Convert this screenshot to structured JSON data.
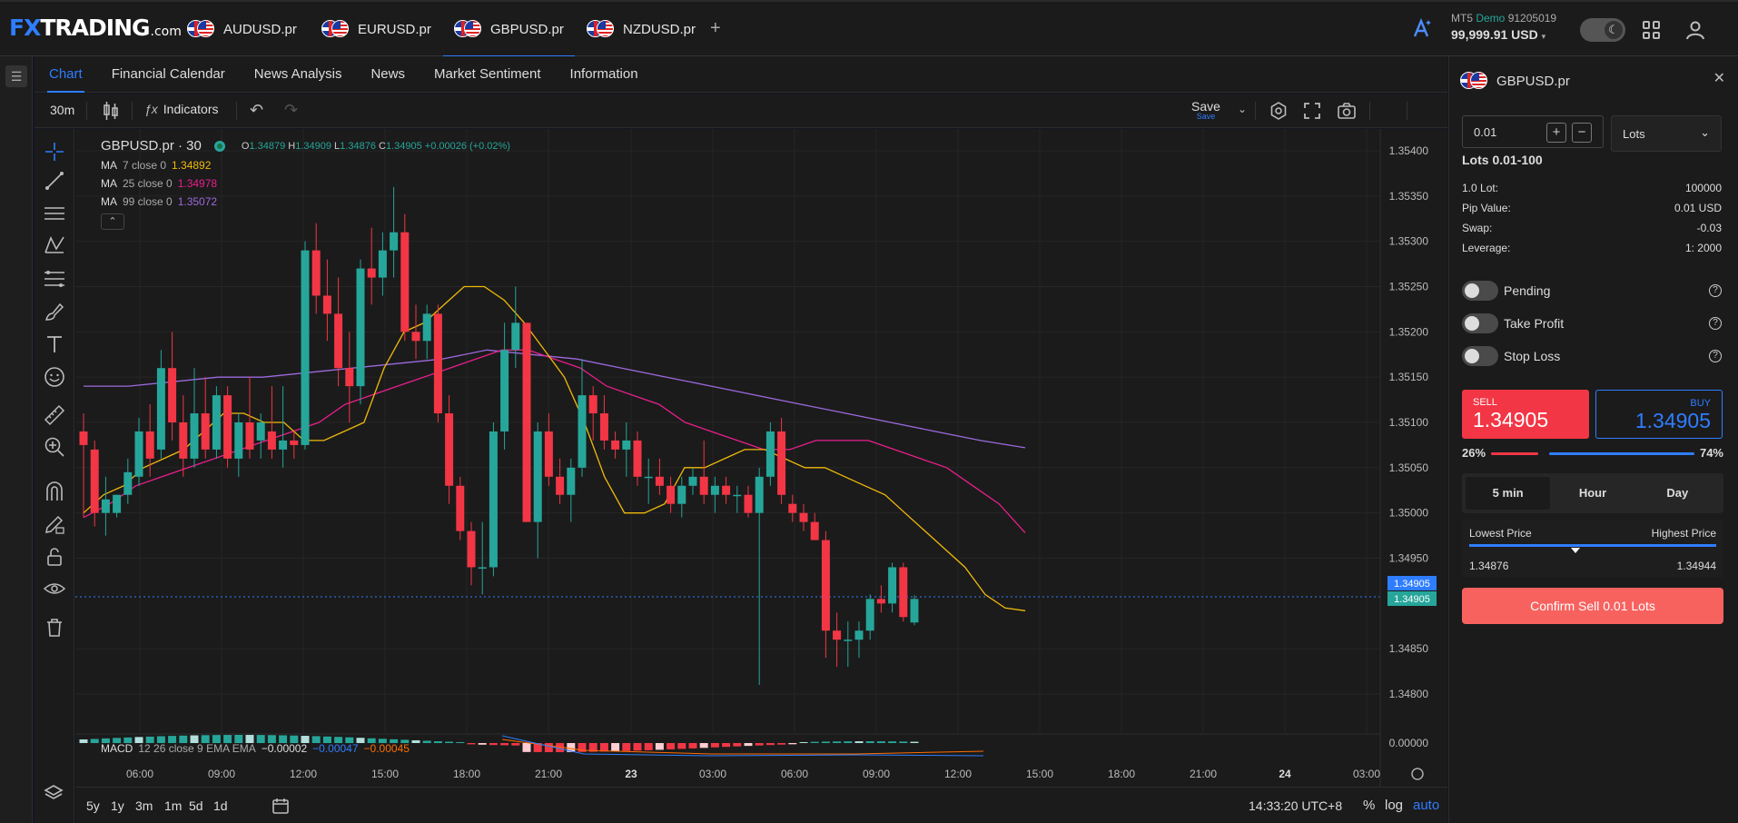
{
  "brand": {
    "logo_fx": "FX",
    "logo_trading": "TRADING",
    "logo_com": ".com"
  },
  "symbol_tabs": [
    {
      "label": "AUDUSD.pr",
      "active": false
    },
    {
      "label": "EURUSD.pr",
      "active": false
    },
    {
      "label": "GBPUSD.pr",
      "active": true
    },
    {
      "label": "NZDUSD.pr",
      "active": false
    }
  ],
  "add_tab_icon": "plus-icon",
  "account": {
    "platform": "MT5",
    "mode": "Demo",
    "number": "91205019",
    "balance": "99,999.91 USD"
  },
  "sub_tabs": [
    "Chart",
    "Financial Calendar",
    "News Analysis",
    "News",
    "Market Sentiment",
    "Information"
  ],
  "active_sub_tab": "Chart",
  "toolbar": {
    "interval": "30m",
    "indicators": "Indicators",
    "save": "Save",
    "save_sub": "Save"
  },
  "legend": {
    "symbol": "GBPUSD.pr · 30",
    "ohlc": {
      "o_label": "O",
      "o": "1.34879",
      "h_label": "H",
      "h": "1.34909",
      "l_label": "L",
      "l": "1.34876",
      "c_label": "C",
      "c": "1.34905",
      "chg": "+0.00026 (+0.02%)"
    },
    "ma": [
      {
        "name": "MA",
        "params": "7 close 0",
        "value": "1.34892",
        "color": "#f0b90b"
      },
      {
        "name": "MA",
        "params": "25 close 0",
        "value": "1.34978",
        "color": "#e91e8c"
      },
      {
        "name": "MA",
        "params": "99 close 0",
        "value": "1.35072",
        "color": "#9c6ade"
      }
    ],
    "macd": {
      "name": "MACD",
      "params": "12 26 close 9 EMA EMA",
      "v1": "−0.00002",
      "v2": "−0.00047",
      "v3": "−0.00045"
    }
  },
  "chart_data": {
    "type": "candlestick",
    "symbol": "GBPUSD.pr",
    "timeframe": "30",
    "y_ticks": [
      "1.35400",
      "1.35350",
      "1.35300",
      "1.35250",
      "1.35200",
      "1.35150",
      "1.35100",
      "1.35050",
      "1.35000",
      "1.34950",
      "1.34850",
      "1.34800"
    ],
    "ylim": [
      1.34795,
      1.354
    ],
    "macd_tick": "0.00000",
    "x_ticks": [
      "06:00",
      "09:00",
      "12:00",
      "15:00",
      "18:00",
      "21:00",
      "23",
      "03:00",
      "06:00",
      "09:00",
      "12:00",
      "15:00",
      "18:00",
      "21:00",
      "24",
      "03:00"
    ],
    "price_labels": [
      "1.34905",
      "1.34905"
    ],
    "candles": [
      {
        "o": 1.3509,
        "h": 1.3511,
        "l": 1.34995,
        "c": 1.35075
      },
      {
        "o": 1.3507,
        "h": 1.3508,
        "l": 1.34985,
        "c": 1.35
      },
      {
        "o": 1.35,
        "h": 1.3504,
        "l": 1.34975,
        "c": 1.35015
      },
      {
        "o": 1.35,
        "h": 1.3502,
        "l": 1.34995,
        "c": 1.3502
      },
      {
        "o": 1.3502,
        "h": 1.3506,
        "l": 1.3501,
        "c": 1.35045
      },
      {
        "o": 1.3504,
        "h": 1.35105,
        "l": 1.3503,
        "c": 1.3509
      },
      {
        "o": 1.3509,
        "h": 1.3512,
        "l": 1.3504,
        "c": 1.3506
      },
      {
        "o": 1.3507,
        "h": 1.3518,
        "l": 1.3506,
        "c": 1.3516
      },
      {
        "o": 1.3516,
        "h": 1.352,
        "l": 1.3508,
        "c": 1.351
      },
      {
        "o": 1.351,
        "h": 1.3513,
        "l": 1.3504,
        "c": 1.3506
      },
      {
        "o": 1.3506,
        "h": 1.3516,
        "l": 1.3505,
        "c": 1.3511
      },
      {
        "o": 1.3511,
        "h": 1.3515,
        "l": 1.3506,
        "c": 1.3507
      },
      {
        "o": 1.3507,
        "h": 1.3514,
        "l": 1.3506,
        "c": 1.3513
      },
      {
        "o": 1.3513,
        "h": 1.3514,
        "l": 1.3505,
        "c": 1.3506
      },
      {
        "o": 1.3506,
        "h": 1.3511,
        "l": 1.3504,
        "c": 1.351
      },
      {
        "o": 1.351,
        "h": 1.3515,
        "l": 1.3506,
        "c": 1.3507
      },
      {
        "o": 1.3508,
        "h": 1.3511,
        "l": 1.3506,
        "c": 1.351
      },
      {
        "o": 1.3509,
        "h": 1.3514,
        "l": 1.3506,
        "c": 1.3507
      },
      {
        "o": 1.3507,
        "h": 1.3514,
        "l": 1.3505,
        "c": 1.3508
      },
      {
        "o": 1.3508,
        "h": 1.3509,
        "l": 1.3506,
        "c": 1.35075
      },
      {
        "o": 1.35075,
        "h": 1.353,
        "l": 1.3507,
        "c": 1.3529
      },
      {
        "o": 1.3529,
        "h": 1.3532,
        "l": 1.3522,
        "c": 1.3524
      },
      {
        "o": 1.3524,
        "h": 1.3528,
        "l": 1.3519,
        "c": 1.3522
      },
      {
        "o": 1.3522,
        "h": 1.3526,
        "l": 1.3514,
        "c": 1.3516
      },
      {
        "o": 1.3516,
        "h": 1.352,
        "l": 1.351,
        "c": 1.3514
      },
      {
        "o": 1.3514,
        "h": 1.3528,
        "l": 1.3512,
        "c": 1.3527
      },
      {
        "o": 1.3527,
        "h": 1.35315,
        "l": 1.3523,
        "c": 1.3526
      },
      {
        "o": 1.3526,
        "h": 1.3531,
        "l": 1.3524,
        "c": 1.3529
      },
      {
        "o": 1.3529,
        "h": 1.3536,
        "l": 1.3526,
        "c": 1.3531
      },
      {
        "o": 1.3531,
        "h": 1.3533,
        "l": 1.3519,
        "c": 1.352
      },
      {
        "o": 1.352,
        "h": 1.3523,
        "l": 1.3517,
        "c": 1.3519
      },
      {
        "o": 1.3519,
        "h": 1.3523,
        "l": 1.3517,
        "c": 1.3522
      },
      {
        "o": 1.3522,
        "h": 1.3523,
        "l": 1.351,
        "c": 1.3511
      },
      {
        "o": 1.3511,
        "h": 1.3513,
        "l": 1.3501,
        "c": 1.3503
      },
      {
        "o": 1.3503,
        "h": 1.3504,
        "l": 1.3497,
        "c": 1.3498
      },
      {
        "o": 1.3498,
        "h": 1.3499,
        "l": 1.3492,
        "c": 1.3494
      },
      {
        "o": 1.3494,
        "h": 1.3499,
        "l": 1.3491,
        "c": 1.3494
      },
      {
        "o": 1.3494,
        "h": 1.351,
        "l": 1.3493,
        "c": 1.3509
      },
      {
        "o": 1.3509,
        "h": 1.3521,
        "l": 1.3507,
        "c": 1.3518
      },
      {
        "o": 1.3518,
        "h": 1.3525,
        "l": 1.3516,
        "c": 1.3521
      },
      {
        "o": 1.3521,
        "h": 1.3521,
        "l": 1.3499,
        "c": 1.3499
      },
      {
        "o": 1.3499,
        "h": 1.351,
        "l": 1.3495,
        "c": 1.3509
      },
      {
        "o": 1.3509,
        "h": 1.3511,
        "l": 1.3503,
        "c": 1.3504
      },
      {
        "o": 1.3504,
        "h": 1.3506,
        "l": 1.3501,
        "c": 1.3502
      },
      {
        "o": 1.3502,
        "h": 1.3506,
        "l": 1.3499,
        "c": 1.3505
      },
      {
        "o": 1.3505,
        "h": 1.3517,
        "l": 1.3504,
        "c": 1.3513
      },
      {
        "o": 1.3513,
        "h": 1.3514,
        "l": 1.3508,
        "c": 1.3511
      },
      {
        "o": 1.3511,
        "h": 1.3513,
        "l": 1.3507,
        "c": 1.3508
      },
      {
        "o": 1.3508,
        "h": 1.3509,
        "l": 1.3506,
        "c": 1.3507
      },
      {
        "o": 1.3507,
        "h": 1.351,
        "l": 1.3504,
        "c": 1.3508
      },
      {
        "o": 1.3508,
        "h": 1.3509,
        "l": 1.3503,
        "c": 1.3504
      },
      {
        "o": 1.3504,
        "h": 1.3506,
        "l": 1.3501,
        "c": 1.3504
      },
      {
        "o": 1.3504,
        "h": 1.3506,
        "l": 1.3502,
        "c": 1.3503
      },
      {
        "o": 1.3503,
        "h": 1.3504,
        "l": 1.35,
        "c": 1.3501
      },
      {
        "o": 1.3501,
        "h": 1.3504,
        "l": 1.34995,
        "c": 1.3503
      },
      {
        "o": 1.3503,
        "h": 1.3505,
        "l": 1.3502,
        "c": 1.3504
      },
      {
        "o": 1.3504,
        "h": 1.3508,
        "l": 1.3501,
        "c": 1.3502
      },
      {
        "o": 1.3502,
        "h": 1.3504,
        "l": 1.35,
        "c": 1.3503
      },
      {
        "o": 1.3503,
        "h": 1.3504,
        "l": 1.3501,
        "c": 1.3502
      },
      {
        "o": 1.3502,
        "h": 1.3503,
        "l": 1.35,
        "c": 1.3502
      },
      {
        "o": 1.3502,
        "h": 1.3503,
        "l": 1.34995,
        "c": 1.35
      },
      {
        "o": 1.35,
        "h": 1.3505,
        "l": 1.3481,
        "c": 1.3504
      },
      {
        "o": 1.3504,
        "h": 1.351,
        "l": 1.3503,
        "c": 1.3509
      },
      {
        "o": 1.3509,
        "h": 1.35105,
        "l": 1.3501,
        "c": 1.3502
      },
      {
        "o": 1.3501,
        "h": 1.3502,
        "l": 1.3499,
        "c": 1.35
      },
      {
        "o": 1.35,
        "h": 1.3501,
        "l": 1.3498,
        "c": 1.3499
      },
      {
        "o": 1.3499,
        "h": 1.35,
        "l": 1.3497,
        "c": 1.3497
      },
      {
        "o": 1.3497,
        "h": 1.3498,
        "l": 1.3484,
        "c": 1.3487
      },
      {
        "o": 1.3487,
        "h": 1.3489,
        "l": 1.3483,
        "c": 1.3486
      },
      {
        "o": 1.3486,
        "h": 1.3488,
        "l": 1.3483,
        "c": 1.3486
      },
      {
        "o": 1.3486,
        "h": 1.3488,
        "l": 1.3484,
        "c": 1.3487
      },
      {
        "o": 1.3487,
        "h": 1.3491,
        "l": 1.3486,
        "c": 1.34905
      },
      {
        "o": 1.34905,
        "h": 1.3492,
        "l": 1.3489,
        "c": 1.349
      },
      {
        "o": 1.349,
        "h": 1.34945,
        "l": 1.3489,
        "c": 1.3494
      },
      {
        "o": 1.3494,
        "h": 1.34945,
        "l": 1.3488,
        "c": 1.34885
      },
      {
        "o": 1.34879,
        "h": 1.34909,
        "l": 1.34876,
        "c": 1.34905
      }
    ],
    "ma7": [
      1.35,
      1.3502,
      1.3503,
      1.3505,
      1.3506,
      1.3507,
      1.3509,
      1.3511,
      1.3511,
      1.351,
      1.351,
      1.3508,
      1.3508,
      1.3509,
      1.351,
      1.3516,
      1.352,
      1.3521,
      1.3523,
      1.3525,
      1.3525,
      1.35235,
      1.3521,
      1.3518,
      1.3515,
      1.351,
      1.3504,
      1.35,
      1.35,
      1.3501,
      1.3505,
      1.3505,
      1.3506,
      1.3507,
      1.3507,
      1.3506,
      1.3505,
      1.3505,
      1.3504,
      1.3503,
      1.3502,
      1.35,
      1.3498,
      1.3496,
      1.3494,
      1.3491,
      1.34895,
      1.34892
    ],
    "ma25": [
      1.34995,
      1.3501,
      1.3503,
      1.3504,
      1.3505,
      1.3506,
      1.3507,
      1.3508,
      1.3509,
      1.351,
      1.3512,
      1.3513,
      1.3514,
      1.3515,
      1.3516,
      1.3517,
      1.3518,
      1.3518,
      1.3517,
      1.3516,
      1.3514,
      1.3513,
      1.3512,
      1.351,
      1.3509,
      1.3508,
      1.3507,
      1.3507,
      1.3508,
      1.3508,
      1.3508,
      1.3507,
      1.3506,
      1.3505,
      1.3503,
      1.3501,
      1.34978
    ],
    "ma99": [
      1.3514,
      1.3514,
      1.35145,
      1.3515,
      1.3515,
      1.35155,
      1.3516,
      1.35165,
      1.3517,
      1.3518,
      1.35175,
      1.3517,
      1.3516,
      1.3515,
      1.3514,
      1.3513,
      1.3512,
      1.3511,
      1.351,
      1.3509,
      1.3508,
      1.35072
    ]
  },
  "bottom_bar": {
    "ranges": [
      "5y",
      "1y",
      "3m",
      "1m",
      "5d",
      "1d"
    ],
    "time": "14:33:20 UTC+8",
    "pct": "%",
    "log": "log",
    "auto": "auto"
  },
  "order": {
    "symbol": "GBPUSD.pr",
    "lot_value": "0.01",
    "unit": "Lots",
    "lot_range": "Lots 0.01-100",
    "specs": [
      {
        "k": "1.0 Lot:",
        "v": "100000"
      },
      {
        "k": "Pip Value:",
        "v": "0.01 USD"
      },
      {
        "k": "Swap:",
        "v": "-0.03"
      },
      {
        "k": "Leverage:",
        "v": "1: 2000"
      }
    ],
    "toggles": [
      {
        "label": "Pending",
        "on": false
      },
      {
        "label": "Take Profit",
        "on": false
      },
      {
        "label": "Stop Loss",
        "on": false
      }
    ],
    "sell_label": "SELL",
    "sell_price": "1.34905",
    "buy_label": "BUY",
    "buy_price": "1.34905",
    "sell_pct": "26%",
    "buy_pct": "74%",
    "sell_fraction": 0.26,
    "periods": [
      "5 min",
      "Hour",
      "Day"
    ],
    "active_period": "5 min",
    "lowest_label": "Lowest Price",
    "highest_label": "Highest Price",
    "lowest": "1.34876",
    "highest": "1.34944",
    "current_fraction": 0.43,
    "confirm": "Confirm Sell 0.01 Lots"
  },
  "colors": {
    "up": "#26a69a",
    "down": "#f23645",
    "accent": "#2f7dff"
  }
}
